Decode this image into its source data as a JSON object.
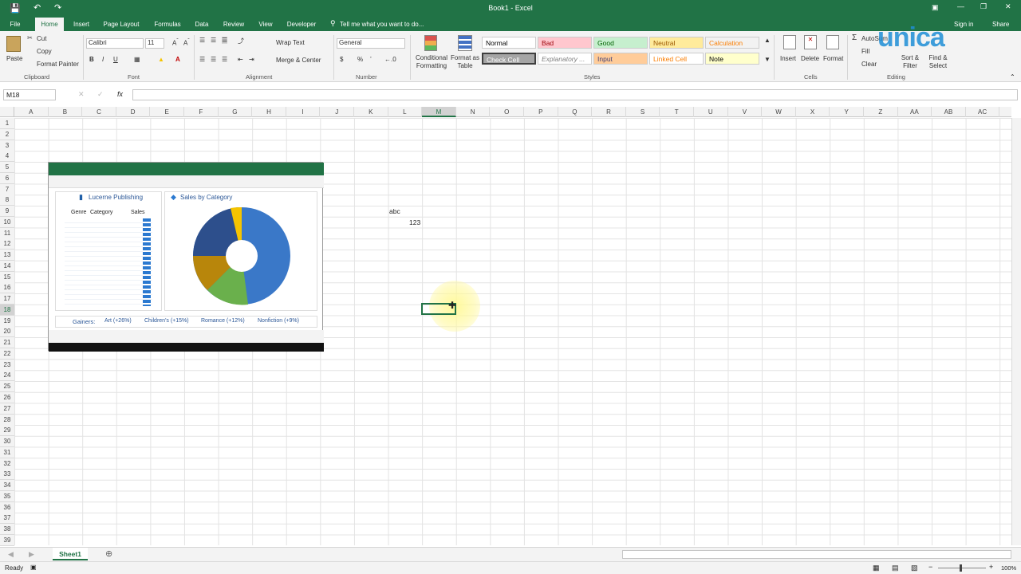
{
  "window": {
    "title": "Book1 - Excel",
    "signin": "Sign in",
    "share": "Share",
    "logo": "unica"
  },
  "tabs": [
    "File",
    "Home",
    "Insert",
    "Page Layout",
    "Formulas",
    "Data",
    "Review",
    "View",
    "Developer"
  ],
  "tellme": "Tell me what you want to do...",
  "clipboard": {
    "paste": "Paste",
    "cut": "Cut",
    "copy": "Copy",
    "format_painter": "Format Painter",
    "label": "Clipboard"
  },
  "font": {
    "name": "Calibri",
    "size": "11",
    "label": "Font"
  },
  "alignment": {
    "wrap": "Wrap Text",
    "merge": "Merge & Center",
    "label": "Alignment"
  },
  "number": {
    "format": "General",
    "label": "Number"
  },
  "styles": {
    "conditional": "Conditional Formatting",
    "format_table": "Format as Table",
    "label": "Styles",
    "cells": [
      {
        "name": "Normal",
        "bg": "#ffffff",
        "fg": "#000000"
      },
      {
        "name": "Bad",
        "bg": "#ffc7ce",
        "fg": "#9c0006"
      },
      {
        "name": "Good",
        "bg": "#c6efce",
        "fg": "#006100"
      },
      {
        "name": "Neutral",
        "bg": "#ffeb9c",
        "fg": "#9c5700"
      },
      {
        "name": "Calculation",
        "bg": "#f2f2f2",
        "fg": "#fa7d00"
      },
      {
        "name": "Check Cell",
        "bg": "#a5a5a5",
        "fg": "#ffffff"
      },
      {
        "name": "Explanatory ...",
        "bg": "#ffffff",
        "fg": "#7f7f7f"
      },
      {
        "name": "Input",
        "bg": "#ffcc99",
        "fg": "#3f3f76"
      },
      {
        "name": "Linked Cell",
        "bg": "#ffffff",
        "fg": "#fa7d00"
      },
      {
        "name": "Note",
        "bg": "#ffffcc",
        "fg": "#000000"
      }
    ]
  },
  "cells_group": {
    "insert": "Insert",
    "delete": "Delete",
    "format": "Format",
    "label": "Cells"
  },
  "editing": {
    "autosum": "AutoSum",
    "fill": "Fill",
    "clear": "Clear",
    "sort": "Sort & Filter",
    "find": "Find & Select",
    "label": "Editing"
  },
  "namebox": "M18",
  "fx": "fx",
  "columns": [
    "A",
    "B",
    "C",
    "D",
    "E",
    "F",
    "G",
    "H",
    "I",
    "J",
    "K",
    "L",
    "M",
    "N",
    "O",
    "P",
    "Q",
    "R",
    "S",
    "T",
    "U",
    "V",
    "W",
    "X",
    "Y",
    "Z",
    "AA",
    "AB",
    "AC"
  ],
  "cells": {
    "L9": "abc",
    "L10": "123"
  },
  "image": {
    "title1": "Lucerne Publishing",
    "title2": "Sales by Category",
    "headers": [
      "Genre",
      "Category",
      "Sales"
    ],
    "gainers": [
      "Gainers:",
      "Art (+26%)",
      "Children's (+15%)",
      "Romance (+12%)",
      "Nonfiction (+9%)"
    ]
  },
  "sheet": {
    "tab": "Sheet1"
  },
  "status": {
    "ready": "Ready",
    "zoom": "100%"
  }
}
